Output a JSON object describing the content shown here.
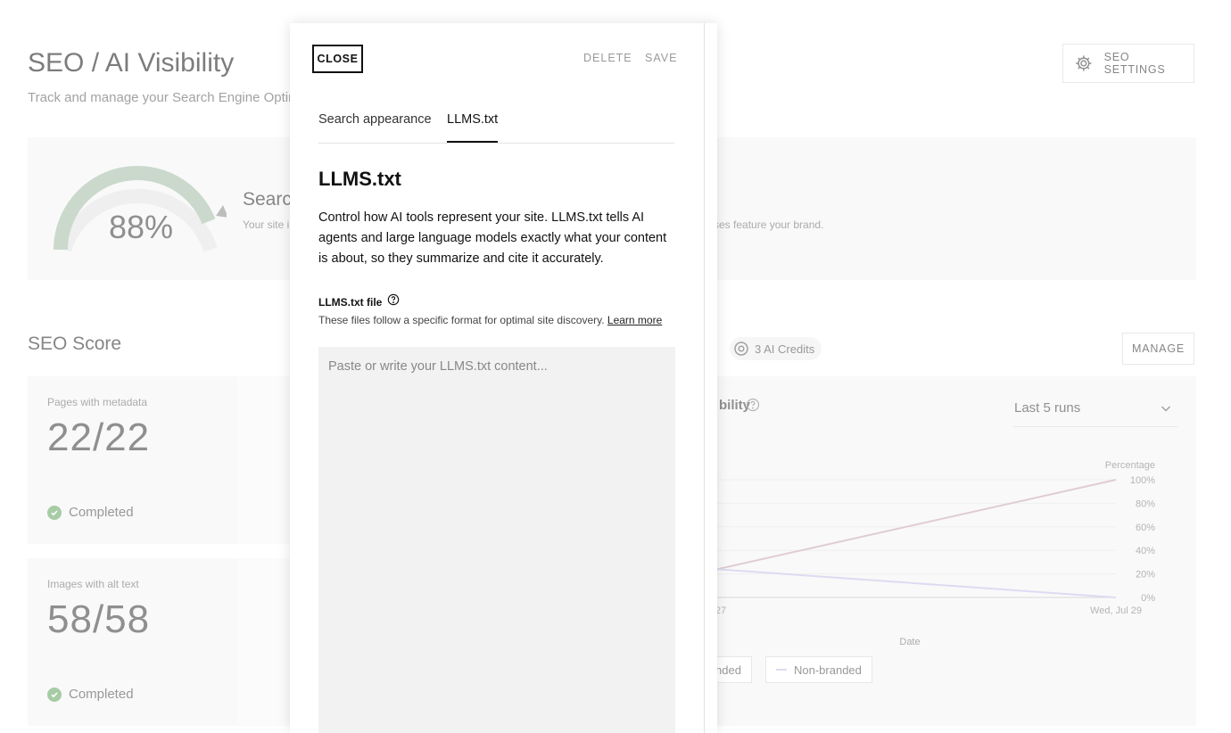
{
  "page": {
    "title": "SEO / AI Visibility",
    "subtitle": "Track and manage your Search Engine Optim",
    "settings_label": "SEO SETTINGS"
  },
  "summary": {
    "score": "88%",
    "score_fraction": 0.88,
    "heading": "Searc",
    "description": "Your site i",
    "description_right": "ses feature your brand."
  },
  "seo_score": {
    "title": "SEO Score",
    "cards": [
      {
        "label": "Pages with metadata",
        "value": "22/22",
        "status": "Completed"
      },
      {
        "label": "Images with alt text",
        "value": "58/58",
        "status": "Completed"
      }
    ]
  },
  "ai": {
    "credits": "3 AI Credits",
    "manage_label": "MANAGE",
    "chart_title": "bility",
    "runs_select": "Last 5 runs",
    "legend": [
      "nded",
      "Non-branded"
    ]
  },
  "chart_data": {
    "type": "line",
    "ylabel": "Percentage",
    "xlabel": "Date",
    "y_ticks": [
      "100%",
      "80%",
      "60%",
      "40%",
      "20%",
      "0%"
    ],
    "ylim": [
      0,
      100
    ],
    "x_ticks": [
      "27",
      "Wed, Jul 29"
    ],
    "series": [
      {
        "values": [
          24,
          100
        ],
        "color": "#c7a3ad"
      },
      {
        "name": "Non-branded",
        "values": [
          24,
          0
        ],
        "color": "#c3bde6"
      }
    ]
  },
  "modal": {
    "close_label": "CLOSE",
    "delete_label": "DELETE",
    "save_label": "SAVE",
    "tabs": [
      "Search appearance",
      "LLMS.txt"
    ],
    "active_tab": "LLMS.txt",
    "heading": "LLMS.txt",
    "intro": "Control how AI tools represent your site. LLMS.txt tells AI agents and large language models exactly what your content is about, so they summarize and cite it accurately.",
    "file_label": "LLMS.txt file",
    "file_description": "These files follow a specific format for optimal site discovery.",
    "learn_more": "Learn more",
    "textarea_placeholder": "Paste or write your LLMS.txt content..."
  }
}
